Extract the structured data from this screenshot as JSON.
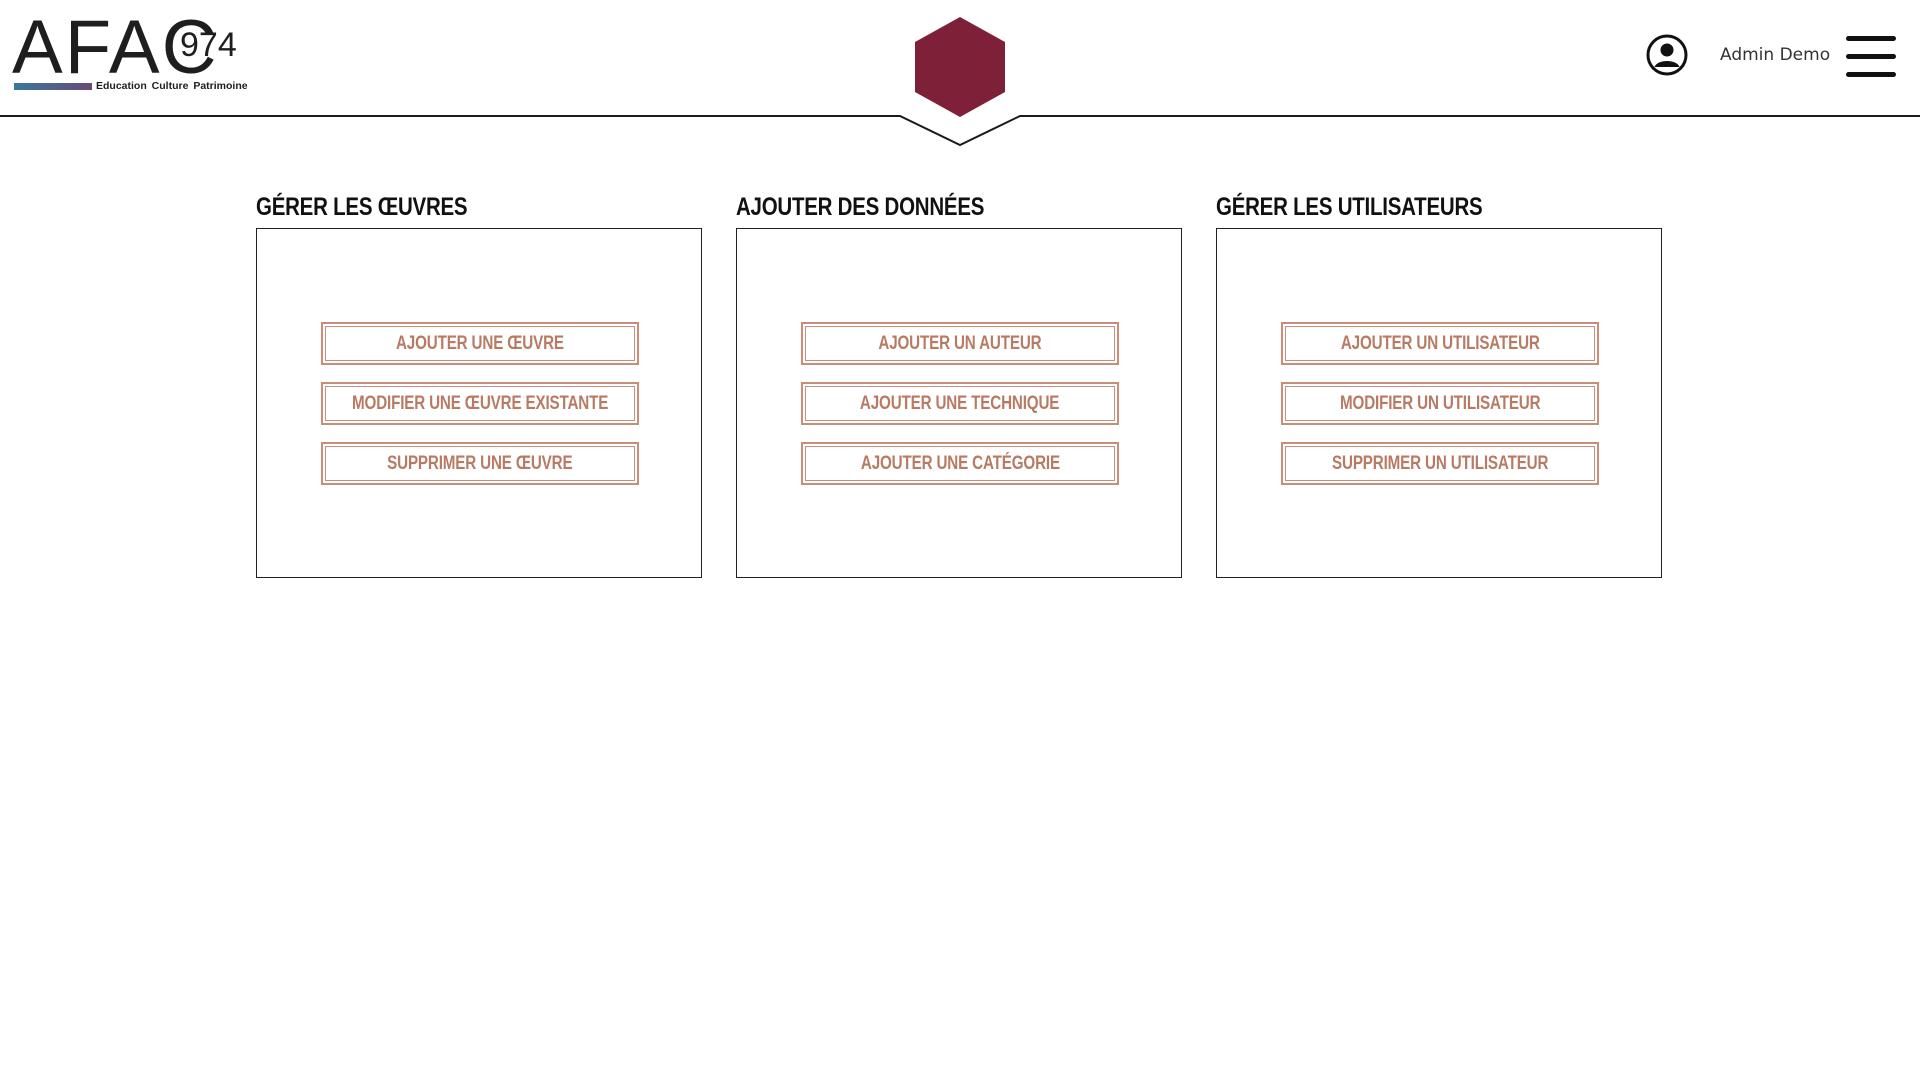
{
  "header": {
    "logo": {
      "letters": "AFAC",
      "number": "974",
      "tagline": "Education  Culture  Patrimoine"
    },
    "user": {
      "name": "Admin Demo",
      "icon": "user-circle-icon"
    },
    "menu_icon": "hamburger-menu-icon",
    "center_emblem_icon": "hexagon-icon"
  },
  "colors": {
    "brand": "#7f2039",
    "button_text": "#b97a63",
    "button_border": "#c98e79"
  },
  "panels": [
    {
      "heading": "GÉRER LES ŒUVRES",
      "buttons": [
        "AJOUTER UNE ŒUVRE",
        "MODIFIER UNE ŒUVRE EXISTANTE",
        "SUPPRIMER UNE ŒUVRE"
      ]
    },
    {
      "heading": "AJOUTER DES DONNÉES",
      "buttons": [
        "AJOUTER UN AUTEUR",
        "AJOUTER UNE TECHNIQUE",
        "AJOUTER UNE CATÉGORIE"
      ]
    },
    {
      "heading": "GÉRER LES UTILISATEURS",
      "buttons": [
        "AJOUTER UN UTILISATEUR",
        "MODIFIER UN UTILISATEUR",
        "SUPPRIMER UN UTILISATEUR"
      ]
    }
  ]
}
